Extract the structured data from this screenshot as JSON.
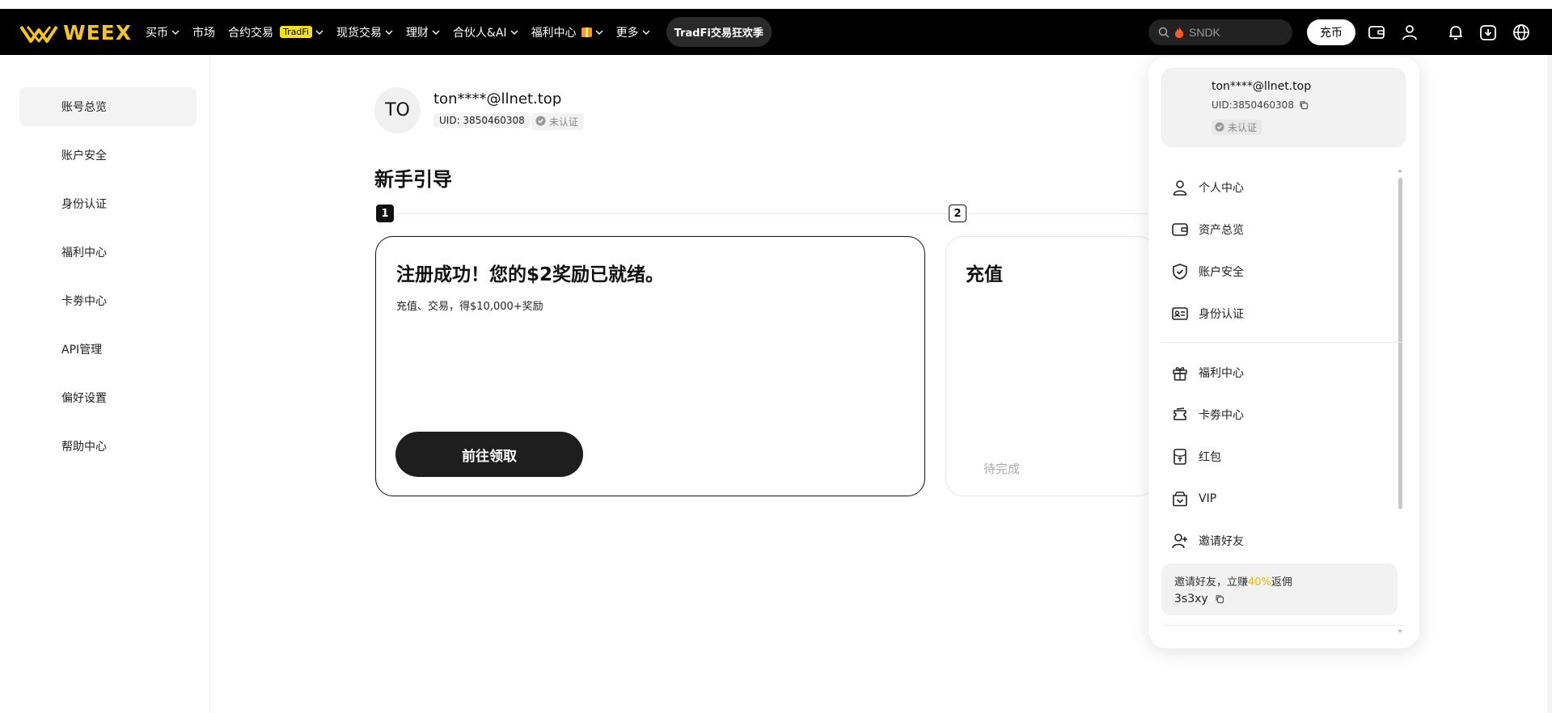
{
  "brand": {
    "name": "WEEX",
    "color": "#f5c518"
  },
  "nav": {
    "items": [
      {
        "label": "买币",
        "dropdown": true
      },
      {
        "label": "市场",
        "dropdown": false
      },
      {
        "label": "合约交易",
        "tag": "TradFi",
        "dropdown": true
      },
      {
        "label": "现货交易",
        "dropdown": true
      },
      {
        "label": "理财",
        "dropdown": true
      },
      {
        "label": "合伙人&AI",
        "dropdown": true
      },
      {
        "label": "福利中心",
        "badge": "gift-icon",
        "dropdown": true
      },
      {
        "label": "更多",
        "dropdown": true
      }
    ],
    "promo": "TradFi交易狂欢季"
  },
  "header": {
    "search_placeholder": "SNDK",
    "deposit_label": "充币",
    "icons": [
      "wallet-icon",
      "user-icon",
      "bell-icon",
      "download-icon",
      "globe-icon"
    ]
  },
  "sidebar": {
    "items": [
      {
        "label": "账号总览",
        "active": true
      },
      {
        "label": "账户安全"
      },
      {
        "label": "身份认证"
      },
      {
        "label": "福利中心"
      },
      {
        "label": "卡劵中心"
      },
      {
        "label": "API管理"
      },
      {
        "label": "偏好设置"
      },
      {
        "label": "帮助中心"
      }
    ]
  },
  "profile": {
    "avatar_initials": "TO",
    "email": "ton****@llnet.top",
    "uid": "UID: 3850460308",
    "status": "未认证"
  },
  "guide": {
    "title": "新手引导",
    "steps": [
      {
        "number": "1",
        "title": "注册成功！您的$2奖励已就绪。",
        "subtitle": "充值、交易，得$10,000+奖励",
        "button": "前往领取"
      },
      {
        "number": "2",
        "title": "充值",
        "status": "待完成"
      }
    ]
  },
  "dropdown": {
    "email": "ton****@llnet.top",
    "uid": "UID:3850460308",
    "status": "未认证",
    "menu": [
      {
        "label": "个人中心",
        "icon": "user-icon"
      },
      {
        "label": "资产总览",
        "icon": "wallet-icon"
      },
      {
        "label": "账户安全",
        "icon": "shield-icon"
      },
      {
        "label": "身份认证",
        "icon": "id-card-icon"
      },
      {
        "label": "福利中心",
        "icon": "gift-icon"
      },
      {
        "label": "卡劵中心",
        "icon": "ticket-icon"
      },
      {
        "label": "红包",
        "icon": "red-packet-icon"
      },
      {
        "label": "VIP",
        "icon": "vip-icon"
      },
      {
        "label": "邀请好友",
        "icon": "add-user-icon"
      }
    ],
    "invite": {
      "prefix": "邀请好友，立赚",
      "highlight": "40%",
      "suffix": "返佣",
      "code": "3s3xy"
    }
  }
}
